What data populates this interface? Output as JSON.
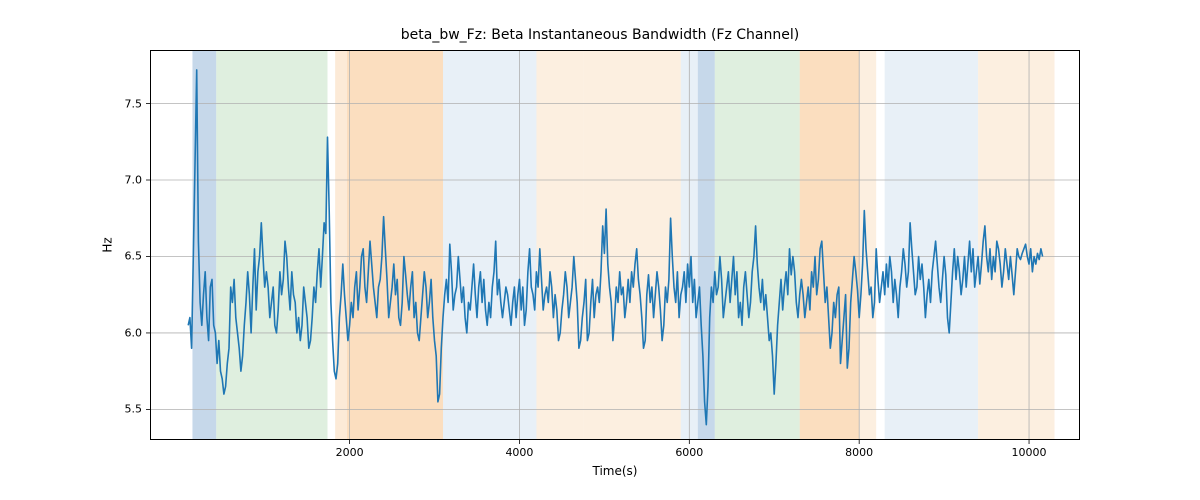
{
  "chart_data": {
    "type": "line",
    "title": "beta_bw_Fz: Beta Instantaneous Bandwidth (Fz Channel)",
    "xlabel": "Time(s)",
    "ylabel": "Hz",
    "xlim": [
      -350,
      10600
    ],
    "ylim": [
      5.3,
      7.85
    ],
    "xticks": [
      2000,
      4000,
      6000,
      8000,
      10000
    ],
    "yticks": [
      5.5,
      6.0,
      6.5,
      7.0,
      7.5
    ],
    "line_color": "#1f77b4",
    "bands": [
      {
        "x0": 150,
        "x1": 430,
        "color": "#98b8d8",
        "alpha": 0.55
      },
      {
        "x0": 430,
        "x1": 1740,
        "color": "#c5e1c5",
        "alpha": 0.55
      },
      {
        "x0": 1830,
        "x1": 1970,
        "color": "#f9d9b6",
        "alpha": 0.55
      },
      {
        "x0": 1970,
        "x1": 3100,
        "color": "#f7c28a",
        "alpha": 0.55
      },
      {
        "x0": 3100,
        "x1": 4200,
        "color": "#d6e3f0",
        "alpha": 0.55
      },
      {
        "x0": 4200,
        "x1": 4750,
        "color": "#f9e2c7",
        "alpha": 0.55
      },
      {
        "x0": 4750,
        "x1": 5900,
        "color": "#f9e2c7",
        "alpha": 0.55
      },
      {
        "x0": 5900,
        "x1": 6100,
        "color": "#d6e3f0",
        "alpha": 0.55
      },
      {
        "x0": 6100,
        "x1": 6300,
        "color": "#98b8d8",
        "alpha": 0.55
      },
      {
        "x0": 6300,
        "x1": 7300,
        "color": "#c5e1c5",
        "alpha": 0.55
      },
      {
        "x0": 7300,
        "x1": 8000,
        "color": "#f7c28a",
        "alpha": 0.55
      },
      {
        "x0": 8000,
        "x1": 8200,
        "color": "#f9e2c7",
        "alpha": 0.55
      },
      {
        "x0": 8300,
        "x1": 9400,
        "color": "#d6e3f0",
        "alpha": 0.55
      },
      {
        "x0": 9400,
        "x1": 10300,
        "color": "#f9e2c7",
        "alpha": 0.55
      }
    ],
    "series": [
      {
        "name": "beta_bw_Fz",
        "x_start": 100,
        "x_step": 20,
        "values": [
          6.05,
          6.1,
          5.9,
          6.5,
          7.1,
          7.72,
          6.6,
          6.2,
          6.05,
          6.25,
          6.4,
          6.1,
          5.95,
          6.3,
          6.35,
          6.05,
          6.0,
          5.8,
          5.95,
          5.75,
          5.7,
          5.6,
          5.65,
          5.8,
          5.9,
          6.3,
          6.2,
          6.35,
          6.1,
          6.0,
          5.9,
          5.75,
          5.85,
          6.05,
          6.2,
          6.4,
          6.25,
          6.0,
          6.3,
          6.55,
          6.15,
          6.4,
          6.5,
          6.72,
          6.5,
          6.3,
          6.4,
          6.3,
          6.1,
          6.2,
          6.3,
          6.05,
          6.0,
          6.15,
          6.4,
          6.25,
          6.35,
          6.6,
          6.5,
          6.3,
          6.15,
          6.4,
          6.25,
          6.2,
          6.0,
          6.1,
          5.95,
          6.05,
          6.3,
          6.2,
          6.1,
          5.9,
          5.95,
          6.1,
          6.3,
          6.2,
          6.4,
          6.55,
          6.3,
          6.5,
          6.72,
          6.65,
          7.28,
          6.8,
          6.2,
          5.95,
          5.75,
          5.7,
          5.8,
          6.1,
          6.25,
          6.45,
          6.25,
          6.1,
          5.95,
          6.05,
          6.2,
          6.1,
          6.3,
          6.4,
          6.15,
          6.3,
          6.5,
          6.55,
          6.3,
          6.2,
          6.4,
          6.6,
          6.45,
          6.3,
          6.2,
          6.1,
          6.3,
          6.35,
          6.5,
          6.76,
          6.55,
          6.35,
          6.1,
          6.2,
          6.3,
          6.45,
          6.25,
          6.35,
          6.1,
          6.05,
          6.2,
          6.5,
          6.38,
          6.25,
          6.15,
          6.3,
          6.4,
          6.1,
          6.2,
          6.0,
          5.95,
          6.1,
          6.25,
          6.4,
          6.3,
          6.1,
          6.2,
          6.35,
          6.1,
          5.95,
          5.85,
          5.55,
          5.6,
          5.9,
          6.1,
          6.25,
          6.35,
          6.2,
          6.58,
          6.4,
          6.15,
          6.25,
          6.3,
          6.5,
          6.35,
          6.2,
          6.3,
          6.1,
          6.0,
          6.2,
          6.15,
          6.3,
          6.45,
          6.25,
          6.1,
          6.3,
          6.4,
          6.2,
          6.35,
          6.15,
          6.05,
          6.2,
          6.1,
          6.3,
          6.4,
          6.6,
          6.25,
          6.35,
          6.2,
          6.1,
          6.2,
          6.3,
          6.25,
          6.15,
          6.05,
          6.2,
          6.3,
          6.1,
          6.25,
          6.35,
          6.15,
          6.3,
          6.05,
          6.15,
          6.4,
          6.55,
          6.3,
          6.25,
          6.15,
          6.4,
          6.3,
          6.55,
          6.35,
          6.15,
          6.25,
          6.3,
          6.2,
          6.4,
          6.3,
          6.1,
          6.25,
          6.15,
          5.95,
          6.0,
          6.15,
          6.25,
          6.4,
          6.3,
          6.1,
          6.2,
          6.3,
          6.5,
          6.35,
          6.2,
          5.9,
          5.95,
          6.1,
          6.2,
          6.35,
          5.95,
          6.0,
          6.2,
          6.35,
          6.1,
          6.25,
          6.3,
          6.2,
          6.4,
          6.7,
          6.52,
          6.81,
          6.45,
          6.3,
          6.2,
          5.95,
          6.1,
          6.3,
          6.2,
          6.4,
          6.25,
          6.3,
          6.1,
          6.2,
          6.35,
          6.2,
          6.4,
          6.3,
          6.45,
          6.55,
          6.35,
          6.25,
          6.1,
          5.9,
          5.95,
          6.25,
          6.38,
          6.2,
          6.3,
          6.1,
          6.25,
          6.4,
          6.3,
          6.15,
          5.95,
          6.05,
          6.3,
          6.2,
          6.35,
          6.75,
          6.5,
          6.3,
          6.2,
          6.4,
          6.1,
          6.25,
          6.3,
          6.4,
          6.2,
          6.45,
          6.3,
          6.5,
          6.2,
          6.35,
          6.1,
          6.2,
          6.3,
          6.05,
          5.85,
          5.55,
          5.4,
          5.65,
          6.1,
          6.3,
          6.2,
          6.4,
          6.25,
          6.3,
          6.5,
          6.35,
          6.1,
          6.2,
          6.3,
          6.4,
          6.2,
          6.35,
          6.5,
          6.25,
          6.4,
          6.1,
          6.2,
          6.05,
          6.3,
          6.4,
          6.25,
          6.1,
          6.2,
          6.4,
          6.5,
          6.7,
          6.45,
          6.3,
          6.2,
          6.35,
          6.15,
          6.25,
          6.1,
          5.95,
          6.0,
          5.85,
          5.6,
          5.8,
          6.05,
          6.2,
          6.35,
          6.15,
          6.3,
          6.4,
          6.25,
          6.55,
          6.38,
          6.5,
          6.4,
          6.2,
          6.1,
          6.25,
          6.35,
          6.25,
          6.1,
          6.2,
          6.3,
          6.15,
          6.4,
          6.3,
          6.5,
          6.25,
          6.35,
          6.55,
          6.6,
          6.4,
          6.2,
          6.3,
          6.1,
          5.9,
          6.0,
          6.2,
          6.1,
          6.25,
          6.3,
          5.8,
          5.95,
          6.1,
          6.25,
          5.77,
          5.9,
          6.2,
          6.35,
          6.5,
          6.4,
          6.28,
          6.1,
          6.25,
          6.45,
          6.8,
          6.55,
          6.4,
          6.25,
          6.3,
          6.1,
          6.2,
          6.55,
          6.35,
          6.2,
          6.3,
          6.4,
          6.25,
          6.45,
          6.3,
          6.5,
          6.4,
          6.2,
          6.35,
          6.25,
          6.1,
          6.3,
          6.4,
          6.55,
          6.45,
          6.3,
          6.4,
          6.72,
          6.55,
          6.4,
          6.25,
          6.3,
          6.5,
          6.35,
          6.45,
          6.3,
          6.1,
          6.25,
          6.35,
          6.2,
          6.4,
          6.5,
          6.6,
          6.45,
          6.3,
          6.2,
          6.35,
          6.5,
          6.38,
          6.1,
          6.0,
          6.2,
          6.4,
          6.55,
          6.35,
          6.5,
          6.4,
          6.25,
          6.35,
          6.5,
          6.3,
          6.45,
          6.6,
          6.4,
          6.55,
          6.3,
          6.4,
          6.5,
          6.32,
          6.45,
          6.6,
          6.7,
          6.5,
          6.4,
          6.55,
          6.35,
          6.5,
          6.4,
          6.6,
          6.55,
          6.45,
          6.3,
          6.4,
          6.55,
          6.45,
          6.35,
          6.5,
          6.38,
          6.25,
          6.4,
          6.55,
          6.5,
          6.48,
          6.52,
          6.55,
          6.58,
          6.5,
          6.45,
          6.55,
          6.4,
          6.5,
          6.45,
          6.52,
          6.48,
          6.55,
          6.5
        ]
      }
    ]
  }
}
